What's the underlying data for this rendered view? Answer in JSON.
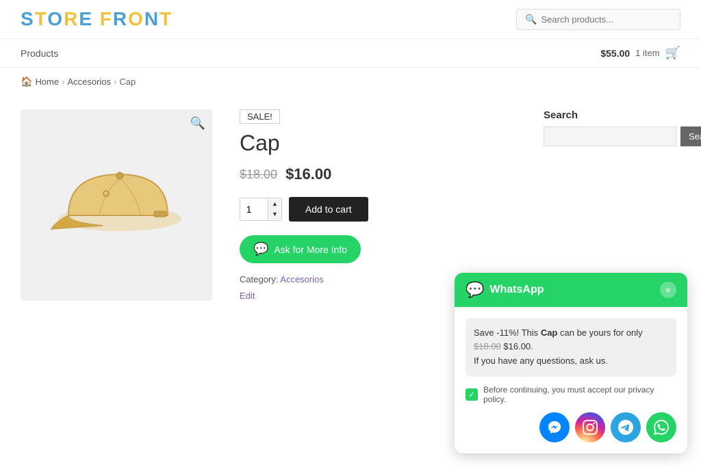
{
  "header": {
    "store_title": "STORE FRONT",
    "search_placeholder": "Search products..."
  },
  "nav": {
    "products_label": "Products",
    "cart_price": "$55.00",
    "cart_items": "1 item"
  },
  "breadcrumb": {
    "home": "Home",
    "category": "Accesorios",
    "current": "Cap"
  },
  "product": {
    "sale_badge": "SALE!",
    "name": "Cap",
    "original_price": "$18.00",
    "sale_price": "$16.00",
    "quantity": "1",
    "add_to_cart": "Add to cart",
    "ask_button": "Ask for More Info",
    "category_label": "Category:",
    "category": "Accesorios",
    "edit": "Edit"
  },
  "sidebar": {
    "search_label": "Search",
    "search_button": "Search",
    "search_placeholder": ""
  },
  "whatsapp_popup": {
    "title": "WhatsApp",
    "message_line1": "Save -11%! This",
    "message_bold": "Cap",
    "message_line2": "can be yours for only",
    "original_price": "$18.00",
    "sale_price": "$16.00",
    "message_line3": "If you have any questions, ask us.",
    "privacy_text": "Before continuing, you must accept our privacy policy.",
    "close_label": "×"
  },
  "icons": {
    "search": "🔍",
    "cart": "🛒",
    "home": "🏠",
    "zoom": "🔍",
    "whatsapp_logo": "💬",
    "checkmark": "✓",
    "messenger": "m",
    "up_arrow": "▲",
    "down_arrow": "▼"
  }
}
